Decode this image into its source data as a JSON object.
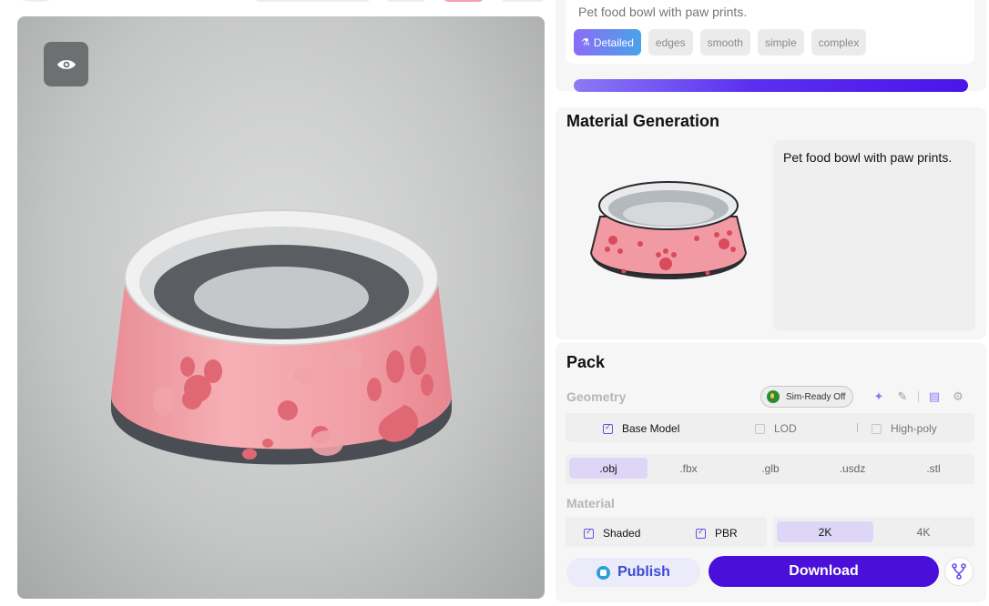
{
  "viewer": {
    "eye_icon": "eye-icon"
  },
  "prompt": {
    "text": "Pet food bowl with paw prints.",
    "chips": [
      {
        "label": "Detailed",
        "active": true,
        "icon": "flask-icon"
      },
      {
        "label": "edges",
        "active": false
      },
      {
        "label": "smooth",
        "active": false
      },
      {
        "label": "simple",
        "active": false
      },
      {
        "label": "complex",
        "active": false
      }
    ],
    "progress": 1.0
  },
  "material": {
    "title": "Material Generation",
    "prompt_text": "Pet food bowl with paw prints."
  },
  "pack": {
    "title": "Pack",
    "geometry_label": "Geometry",
    "sim_ready": "Sim-Ready Off",
    "model_options": [
      {
        "label": "Base Model",
        "checked": true
      },
      {
        "label": "LOD",
        "checked": false
      },
      {
        "label": "High-poly",
        "checked": false
      }
    ],
    "formats": [
      ".obj",
      ".fbx",
      ".glb",
      ".usdz",
      ".stl"
    ],
    "selected_format": ".obj",
    "material_label": "Material",
    "material_options": [
      {
        "label": "Shaded",
        "checked": true
      },
      {
        "label": "PBR",
        "checked": true
      }
    ],
    "resolutions": [
      "2K",
      "4K"
    ],
    "selected_resolution": "2K",
    "publish_label": "Publish",
    "download_label": "Download"
  },
  "colors": {
    "accent": "#4a0fd9",
    "progress_end": "#4a15e8",
    "bowl_pink": "#f4a7ae"
  }
}
